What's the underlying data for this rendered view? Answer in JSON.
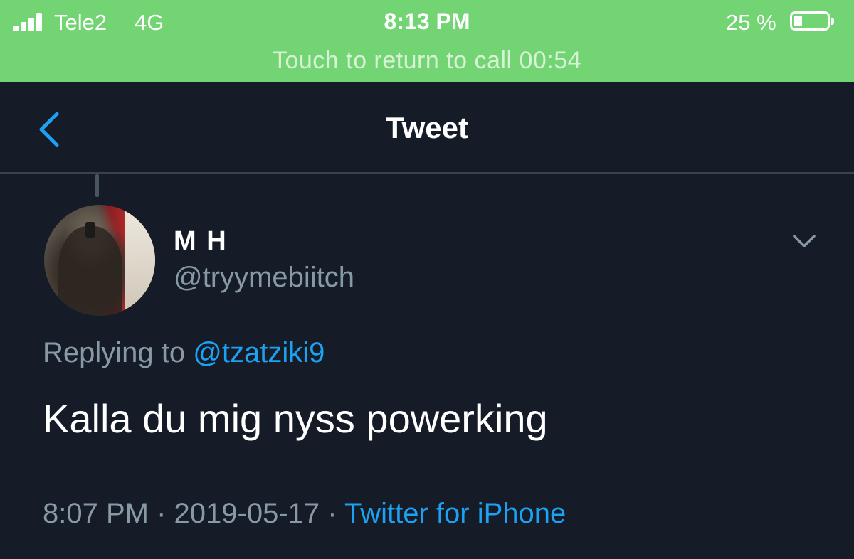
{
  "status_bar": {
    "carrier": "Tele2",
    "network": "4G",
    "time": "8:13 PM",
    "battery_percent_label": "25 %",
    "battery_level": 0.25,
    "call_banner": "Touch to return to call 00:54",
    "background_color": "#72d473"
  },
  "nav": {
    "title": "Tweet",
    "back_icon": "chevron-left-icon",
    "accent_color": "#1da1f2"
  },
  "tweet": {
    "author_name": "M H",
    "author_handle": "@tryymebiitch",
    "replying_prefix": "Replying to",
    "replying_to": "@tzatziki9",
    "text": "Kalla du mig nyss powerking",
    "time": "8:07 PM",
    "sep1": "·",
    "date": "2019-05-17",
    "sep2": "·",
    "source": "Twitter for iPhone",
    "menu_icon": "chevron-down-icon"
  }
}
